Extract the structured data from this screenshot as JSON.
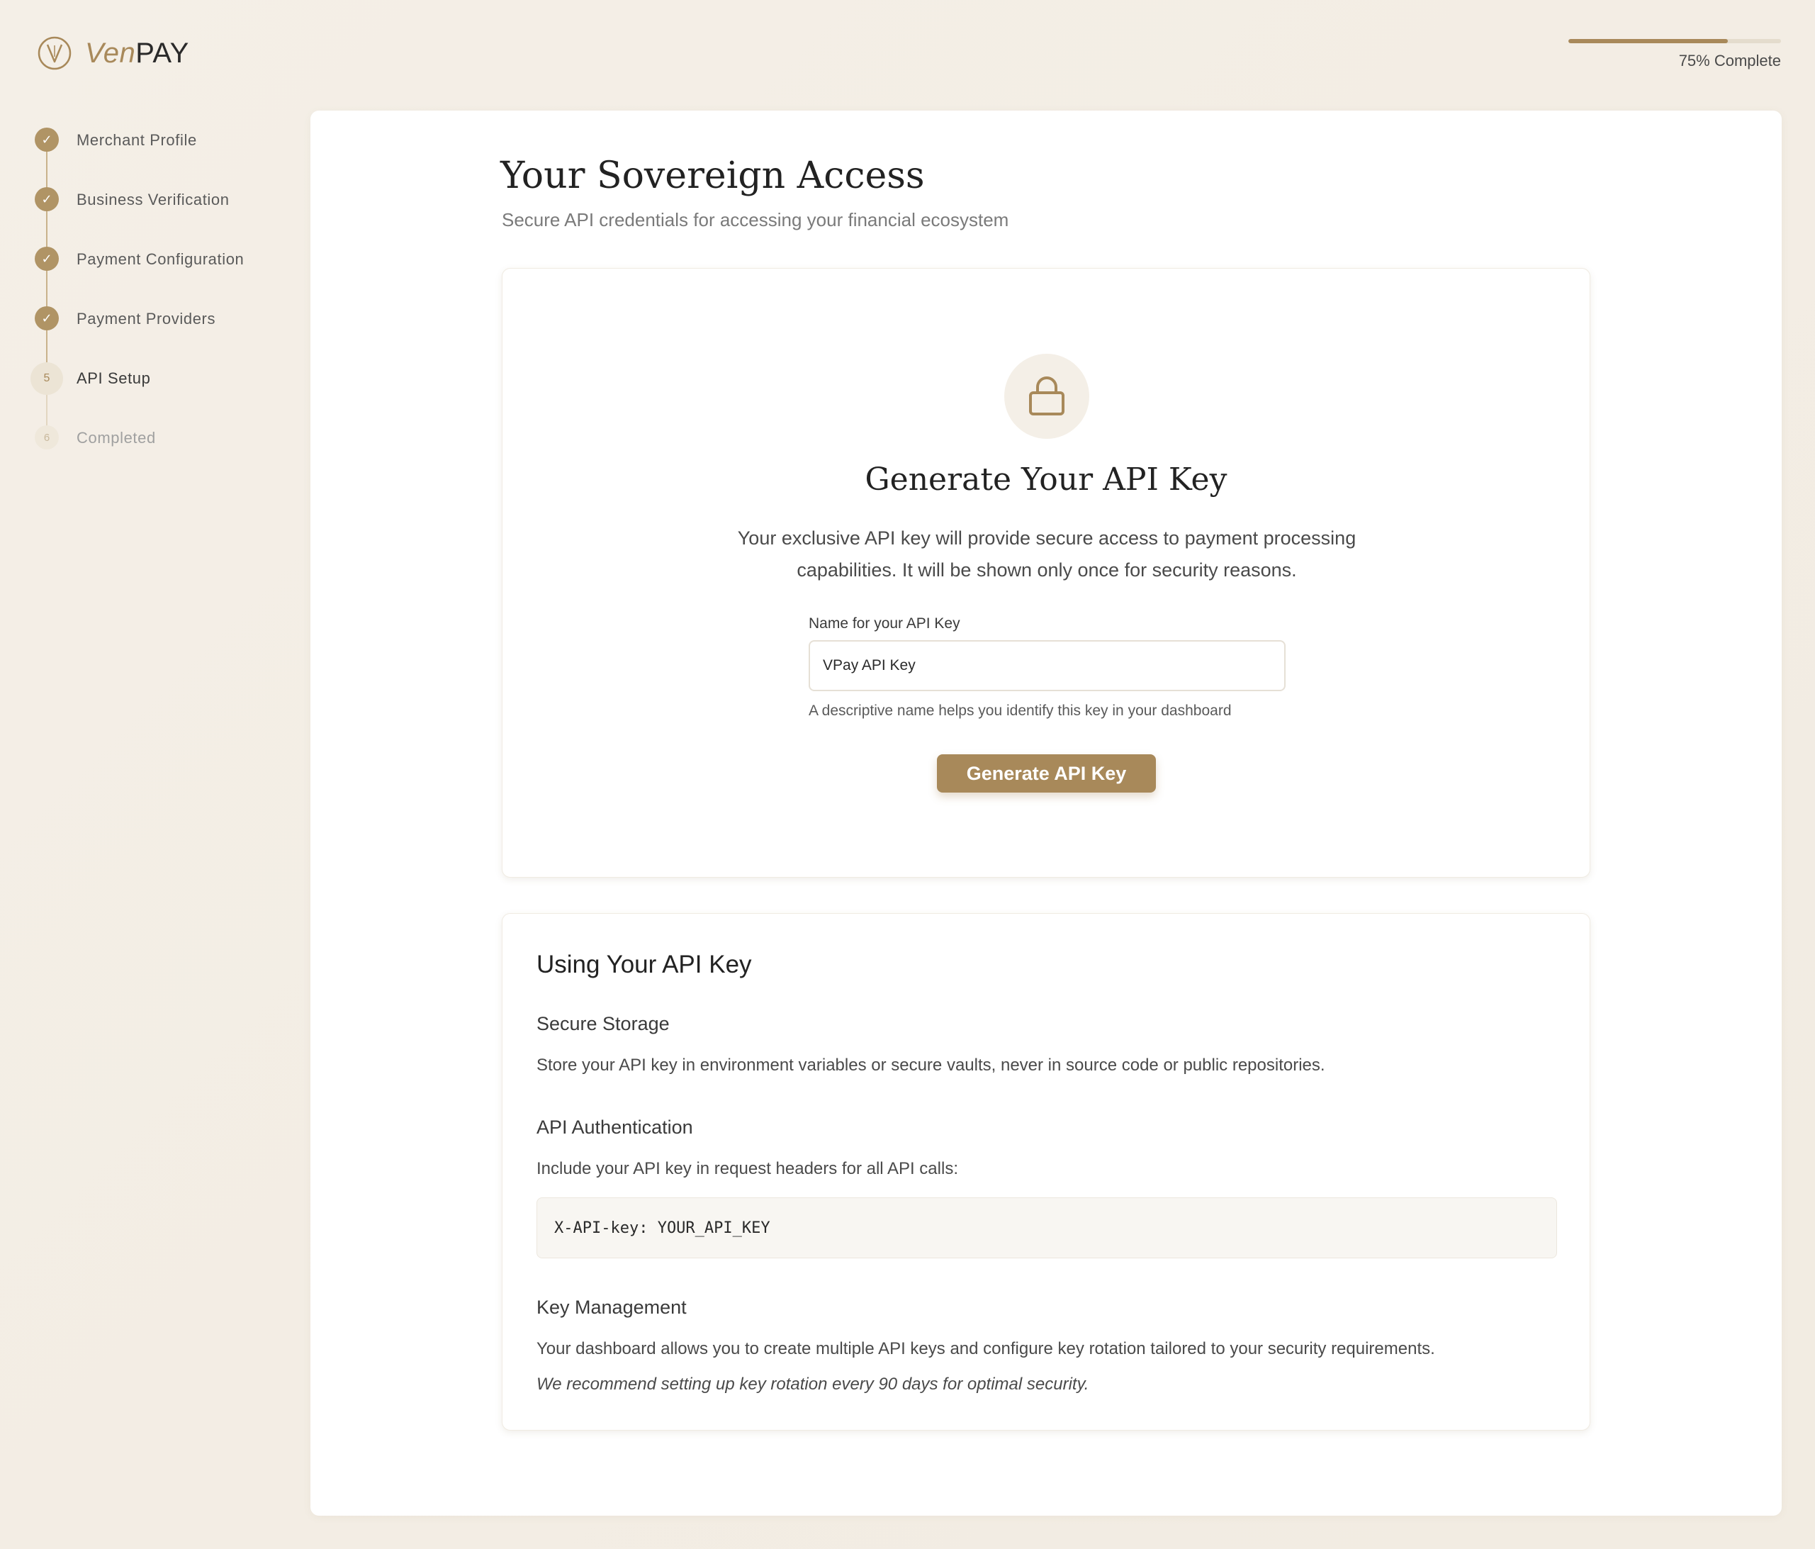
{
  "brand": {
    "prefix": "Ven",
    "suffix": "PAY",
    "accent": "#a8895a"
  },
  "progress": {
    "percent": 75,
    "label": "75% Complete"
  },
  "steps": [
    {
      "number": "1",
      "label": "Merchant Profile",
      "state": "done"
    },
    {
      "number": "2",
      "label": "Business Verification",
      "state": "done"
    },
    {
      "number": "3",
      "label": "Payment Configuration",
      "state": "done"
    },
    {
      "number": "4",
      "label": "Payment Providers",
      "state": "done"
    },
    {
      "number": "5",
      "label": "API Setup",
      "state": "active"
    },
    {
      "number": "6",
      "label": "Completed",
      "state": "pending"
    }
  ],
  "step_check_glyph": "✓",
  "page": {
    "title": "Your Sovereign Access",
    "subtitle": "Secure API credentials for accessing your financial ecosystem"
  },
  "generate": {
    "icon": "lock-icon",
    "title": "Generate Your API Key",
    "description": "Your exclusive API key will provide secure access to payment processing capabilities. It will be shown only once for security reasons.",
    "field_label": "Name for your API Key",
    "field_value": "VPay API Key",
    "field_hint": "A descriptive name helps you identify this key in your dashboard",
    "button_label": "Generate API Key"
  },
  "usage": {
    "title": "Using Your API Key",
    "storage_title": "Secure Storage",
    "storage_text": "Store your API key in environment variables or secure vaults, never in source code or public repositories.",
    "auth_title": "API Authentication",
    "auth_text": "Include your API key in request headers for all API calls:",
    "code": "X-API-key: YOUR_API_KEY",
    "mgmt_title": "Key Management",
    "mgmt_text": "Your dashboard allows you to create multiple API keys and configure key rotation tailored to your security requirements.",
    "mgmt_note": "We recommend setting up key rotation every 90 days for optimal security."
  }
}
